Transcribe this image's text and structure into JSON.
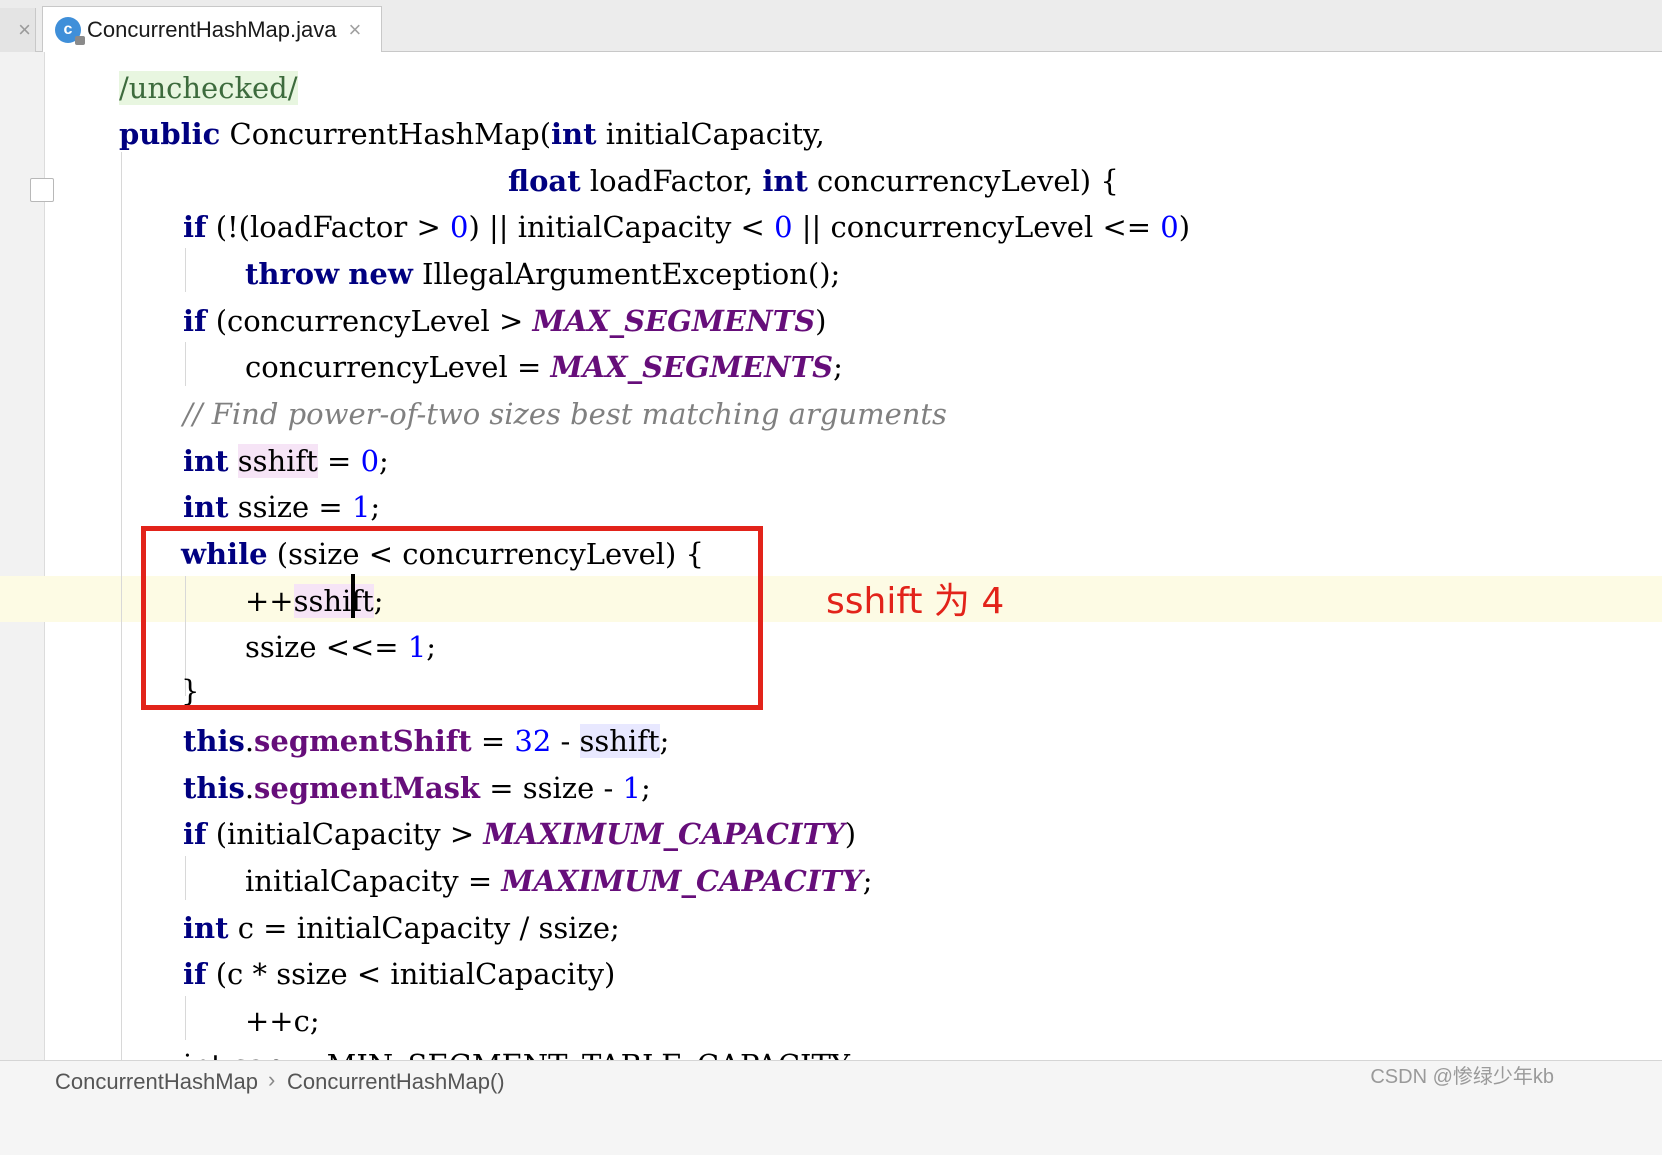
{
  "tab": {
    "title": "ConcurrentHashMap.java",
    "icon_letter": "c",
    "close": "×",
    "left_stub": "×"
  },
  "code": {
    "l1_ann": "/unchecked/",
    "l2_kw": "public",
    "l2_a": " ConcurrentHashMap(",
    "l2_kw2": "int",
    "l2_b": " initialCapacity,",
    "l3_kw": "float",
    "l3_a": " loadFactor, ",
    "l3_kw2": "int",
    "l3_b": " concurrencyLevel) {",
    "l4_kw": "if",
    "l4_a": " (!(loadFactor > ",
    "l4_n1": "0",
    "l4_b": ") || initialCapacity < ",
    "l4_n2": "0",
    "l4_c": " || concurrencyLevel <= ",
    "l4_n3": "0",
    "l4_d": ")",
    "l5_kw": "throw",
    "l5_sp": " ",
    "l5_kw2": "new",
    "l5_a": " IllegalArgumentException();",
    "l6_kw": "if",
    "l6_a": " (concurrencyLevel > ",
    "l6_c": "MAX_SEGMENTS",
    "l6_b": ")",
    "l7_a": "concurrencyLevel = ",
    "l7_c": "MAX_SEGMENTS",
    "l7_b": ";",
    "l8_cmt": "// Find power-of-two sizes best matching arguments",
    "l9_kw": "int",
    "l9_sp": " ",
    "l9_v": "sshift",
    "l9_a": " = ",
    "l9_n": "0",
    "l9_b": ";",
    "l10_kw": "int",
    "l10_a": " ssize = ",
    "l10_n": "1",
    "l10_b": ";",
    "l11_kw": "while",
    "l11_a": " (ssize < concurrencyLevel) {",
    "l12_a": "++",
    "l12_v": "sshift",
    "l12_b": ";",
    "l13_a": "ssize <<= ",
    "l13_n": "1",
    "l13_b": ";",
    "l14_a": "}",
    "l15_kw": "this",
    "l15_dot": ".",
    "l15_f": "segmentShift",
    "l15_a": " = ",
    "l15_n": "32",
    "l15_b": " - ",
    "l15_v": "sshift",
    "l15_c": ";",
    "l16_kw": "this",
    "l16_dot": ".",
    "l16_f": "segmentMask",
    "l16_a": " = ssize - ",
    "l16_n": "1",
    "l16_b": ";",
    "l17_kw": "if",
    "l17_a": " (initialCapacity > ",
    "l17_c": "MAXIMUM_CAPACITY",
    "l17_b": ")",
    "l18_a": "initialCapacity = ",
    "l18_c": "MAXIMUM_CAPACITY",
    "l18_b": ";",
    "l19_kw": "int",
    "l19_a": " c = initialCapacity / ssize;",
    "l20_kw": "if",
    "l20_a": " (c * ssize < initialCapacity)",
    "l21_a": "++c;",
    "l22_a": "int cap = MIN_SEGMENT_TABLE_CAPACITY;"
  },
  "annotation": "sshift 为 4",
  "breadcrumb": {
    "class_name": "ConcurrentHashMap",
    "sep": "›",
    "method_name": "ConcurrentHashMap()"
  },
  "watermark": "CSDN @惨绿少年kb",
  "colors": {
    "keyword": "#000080",
    "number": "#0000ff",
    "constant": "#660e7a",
    "comment": "#808080",
    "annotation_red": "#e2231a"
  }
}
